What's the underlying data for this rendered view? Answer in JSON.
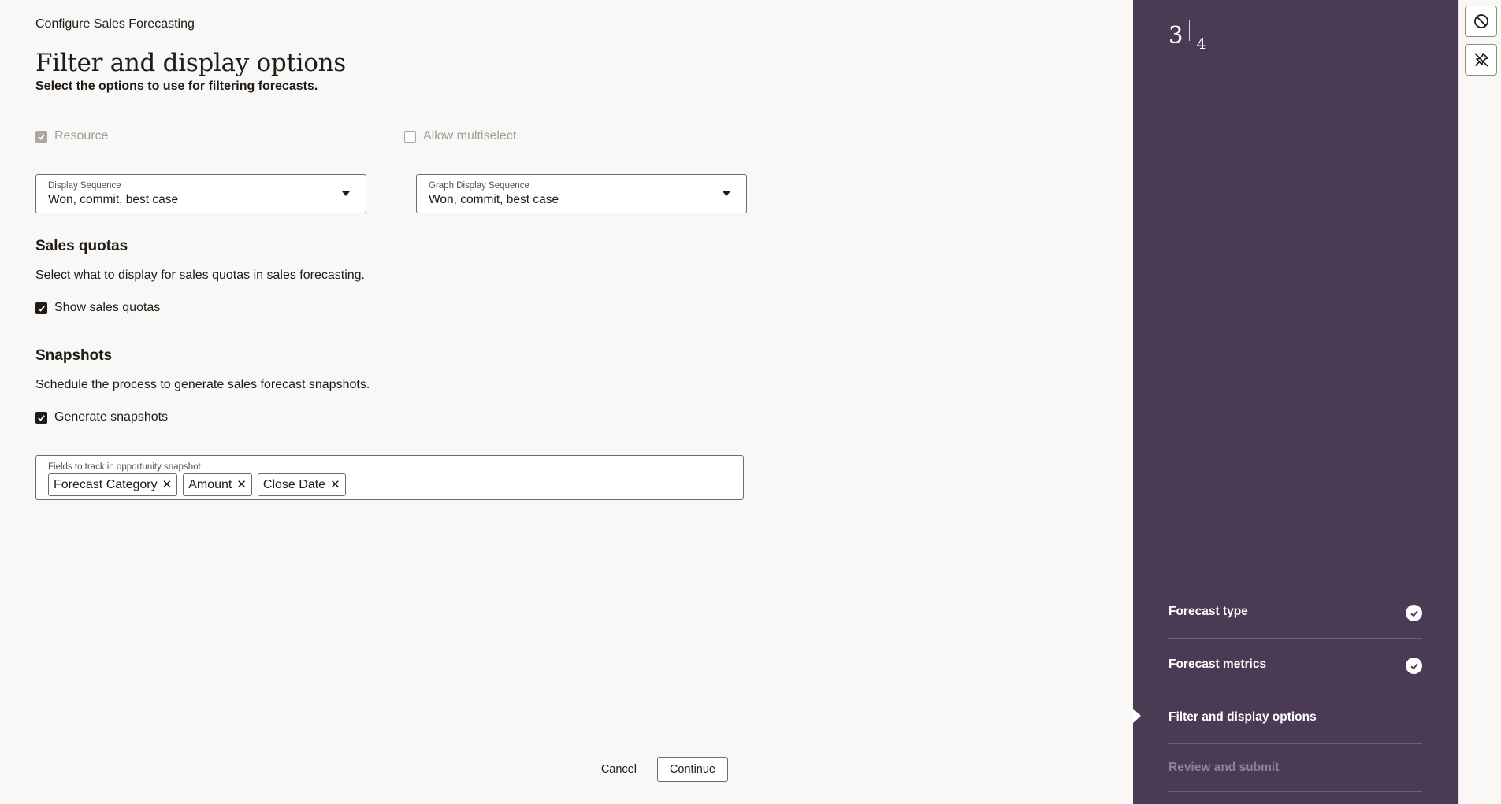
{
  "header": {
    "eyebrow": "Configure Sales Forecasting",
    "title": "Filter and display options",
    "subtitle": "Select the options to use for filtering forecasts."
  },
  "filters": {
    "resource_label": "Resource",
    "resource_checked": true,
    "resource_disabled": true,
    "allow_multiselect_label": "Allow multiselect",
    "allow_multiselect_checked": false,
    "allow_multiselect_disabled": true
  },
  "display_sequence": {
    "label": "Display Sequence",
    "value": "Won, commit, best case"
  },
  "graph_display_sequence": {
    "label": "Graph Display Sequence",
    "value": "Won, commit, best case"
  },
  "sales_quotas": {
    "heading": "Sales quotas",
    "description": "Select what to display for sales quotas in sales forecasting.",
    "checkbox_label": "Show sales quotas",
    "checked": true
  },
  "snapshots": {
    "heading": "Snapshots",
    "description": "Schedule the process to generate sales forecast snapshots.",
    "checkbox_label": "Generate snapshots",
    "checked": true,
    "fields_label": "Fields to track in opportunity snapshot",
    "tags": [
      "Forecast Category",
      "Amount",
      "Close Date"
    ]
  },
  "footer": {
    "cancel_label": "Cancel",
    "continue_label": "Continue"
  },
  "train": {
    "current": "3",
    "total": "4",
    "steps": [
      {
        "label": "Forecast type",
        "status": "complete"
      },
      {
        "label": "Forecast metrics",
        "status": "complete"
      },
      {
        "label": "Filter and display options",
        "status": "current"
      },
      {
        "label": "Review and submit",
        "status": "upcoming"
      }
    ]
  },
  "toolbar": {
    "icons": [
      "block-icon",
      "pin-off-icon"
    ]
  },
  "colors": {
    "rail_bg": "#4a3a54",
    "page_bg": "#faf8f6",
    "text": "#1e1b18"
  }
}
